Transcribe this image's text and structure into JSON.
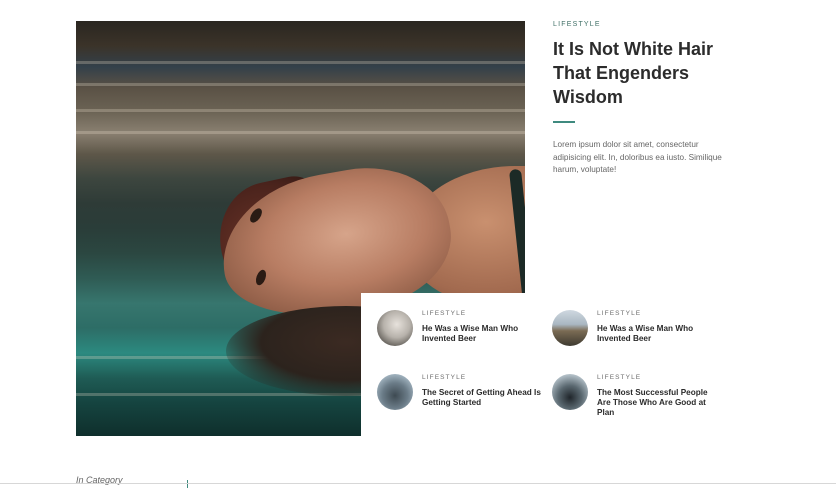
{
  "featured": {
    "category": "LIFESTYLE",
    "title": "It Is Not White Hair That Engenders Wisdom",
    "excerpt": "Lorem ipsum dolor sit amet, consectetur adipisicing elit. In, doloribus ea iusto. Similique harum, voluptate!"
  },
  "posts": [
    {
      "category": "LIFESTYLE",
      "title": "He Was a Wise Man Who Invented Beer",
      "thumb": "person-on-rocks-thumbnail"
    },
    {
      "category": "LIFESTYLE",
      "title": "He Was a Wise Man Who Invented Beer",
      "thumb": "mountain-sunset-thumbnail"
    },
    {
      "category": "LIFESTYLE",
      "title": "The Secret of Getting Ahead Is Getting Started",
      "thumb": "person-sitting-thumbnail"
    },
    {
      "category": "LIFESTYLE",
      "title": "The Most Successful People Are Those Who Are Good at Plan",
      "thumb": "person-by-sea-thumbnail"
    }
  ],
  "bottom": {
    "section_label": "In Category"
  },
  "colors": {
    "accent": "#3f8a7f",
    "category_text": "#3f6f66"
  }
}
